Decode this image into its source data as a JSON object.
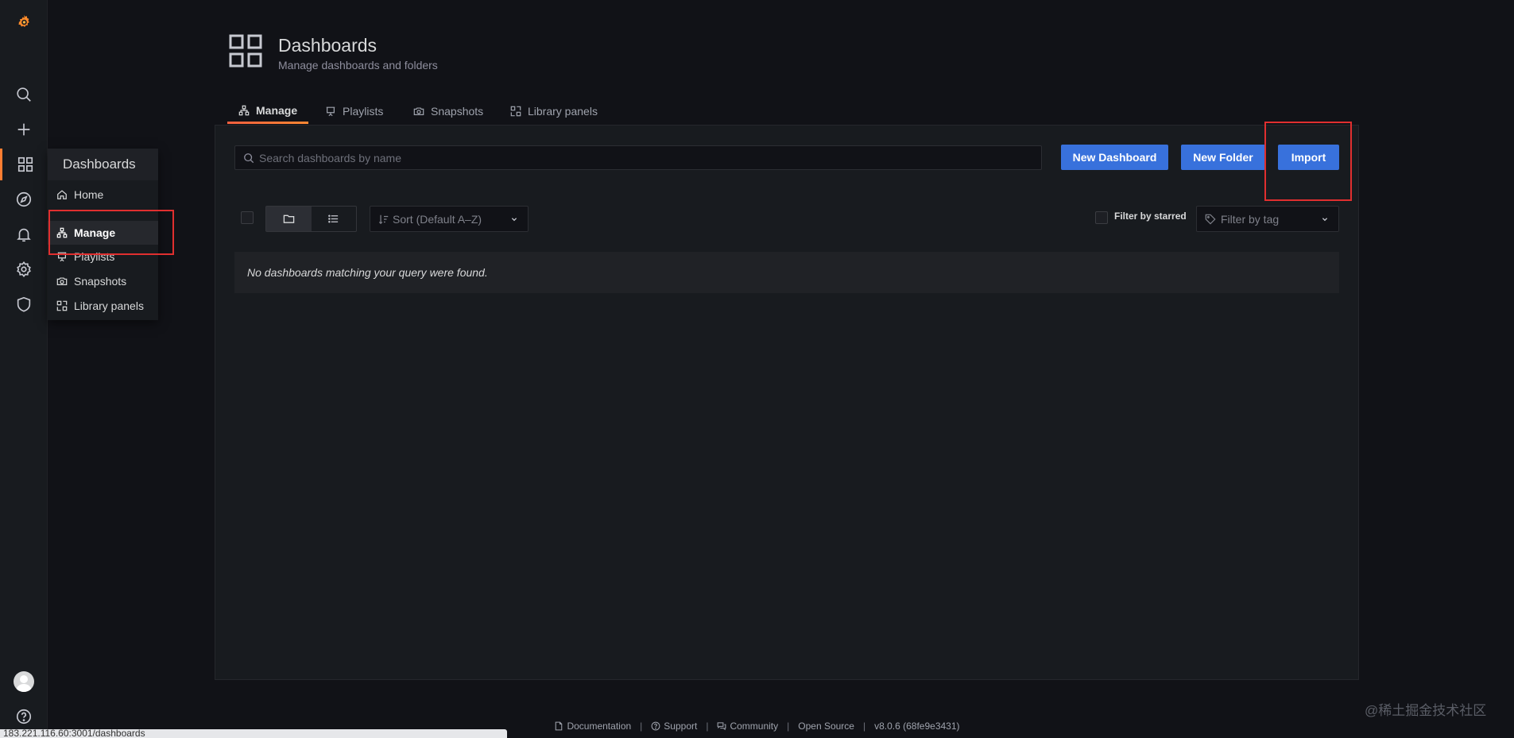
{
  "sidebar": {
    "icons": [
      "grafana-logo-icon",
      "search-icon",
      "plus-icon",
      "dashboards-icon",
      "explore-icon",
      "alerting-icon",
      "configuration-icon",
      "server-admin-icon",
      "user-avatar",
      "help-icon"
    ]
  },
  "flyout": {
    "title": "Dashboards",
    "items": [
      {
        "label": "Home",
        "icon": "home-icon"
      },
      {
        "label": "Manage",
        "icon": "sitemap-icon"
      },
      {
        "label": "Playlists",
        "icon": "presentation-icon"
      },
      {
        "label": "Snapshots",
        "icon": "camera-icon"
      },
      {
        "label": "Library panels",
        "icon": "library-panel-icon"
      }
    ]
  },
  "header": {
    "title": "Dashboards",
    "subtitle": "Manage dashboards and folders"
  },
  "tabs": [
    {
      "label": "Manage",
      "icon": "sitemap-icon",
      "active": true
    },
    {
      "label": "Playlists",
      "icon": "presentation-icon",
      "active": false
    },
    {
      "label": "Snapshots",
      "icon": "camera-icon",
      "active": false
    },
    {
      "label": "Library panels",
      "icon": "library-panel-icon",
      "active": false
    }
  ],
  "search": {
    "placeholder": "Search dashboards by name"
  },
  "buttons": {
    "new_dashboard": "New Dashboard",
    "new_folder": "New Folder",
    "import": "Import"
  },
  "filters": {
    "sort": "Sort (Default A–Z)",
    "starred": "Filter by starred",
    "tag_placeholder": "Filter by tag"
  },
  "empty_message": "No dashboards matching your query were found.",
  "footer": {
    "documentation": "Documentation",
    "support": "Support",
    "community": "Community",
    "open_source": "Open Source",
    "version": "v8.0.6 (68fe9e3431)"
  },
  "watermark": "@稀土掘金技术社区",
  "status_url": "183.221.116.60:3001/dashboards",
  "colors": {
    "accent": "#ff7e32",
    "primary": "#3871dc",
    "highlight": "#e02f2f"
  }
}
